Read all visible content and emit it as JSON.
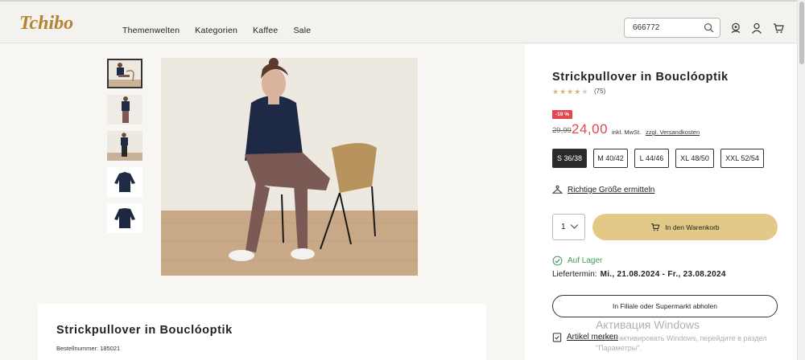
{
  "header": {
    "logo_text": "Tchibo",
    "nav": [
      "Themenwelten",
      "Kategorien",
      "Kaffee",
      "Sale"
    ],
    "search": {
      "value": "666772"
    },
    "icons": [
      "search-icon",
      "location-icon",
      "user-icon",
      "cart-icon"
    ]
  },
  "gallery": {
    "thumbnails": [
      "thumb-1",
      "thumb-2",
      "thumb-3",
      "thumb-4",
      "thumb-5"
    ],
    "active_index": 0
  },
  "product": {
    "title": "Strickpullover in Bouclóoptik",
    "rating": {
      "stars": 4,
      "max": 5,
      "count": "(75)"
    },
    "discount_badge": "-19 %",
    "old_price": "29,99",
    "price": "24,00",
    "price_note": "inkl. MwSt.",
    "shipping_link": "zzgl. Versandkosten",
    "sizes": [
      {
        "label": "S 36/38",
        "selected": true
      },
      {
        "label": "M 40/42",
        "selected": false
      },
      {
        "label": "L 44/46",
        "selected": false
      },
      {
        "label": "XL 48/50",
        "selected": false
      },
      {
        "label": "XXL 52/54",
        "selected": false
      }
    ],
    "size_finder": "Richtige Größe ermitteln",
    "quantity": "1",
    "add_to_cart": "In den Warenkorb",
    "stock": "Auf Lager",
    "delivery_label": "Liefertermin:",
    "delivery_value": "Mi., 21.08.2024 - Fr., 23.08.2024",
    "store_pickup": "In Filiale oder Supermarkt abholen",
    "wishlist": "Artikel merken"
  },
  "details_card": {
    "title": "Strickpullover in Bouclóoptik",
    "order_number": "Bestellnummer: 185021"
  },
  "windows_watermark": {
    "line1": "Активация Windows",
    "line2": "Чтобы активировать Windows, перейдите в раздел",
    "line3": "\"Параметры\"."
  },
  "colors": {
    "accent_gold": "#e2c987",
    "sale_red": "#e2464e",
    "stock_green": "#3d9a5b",
    "logo_brown": "#b5822f"
  }
}
